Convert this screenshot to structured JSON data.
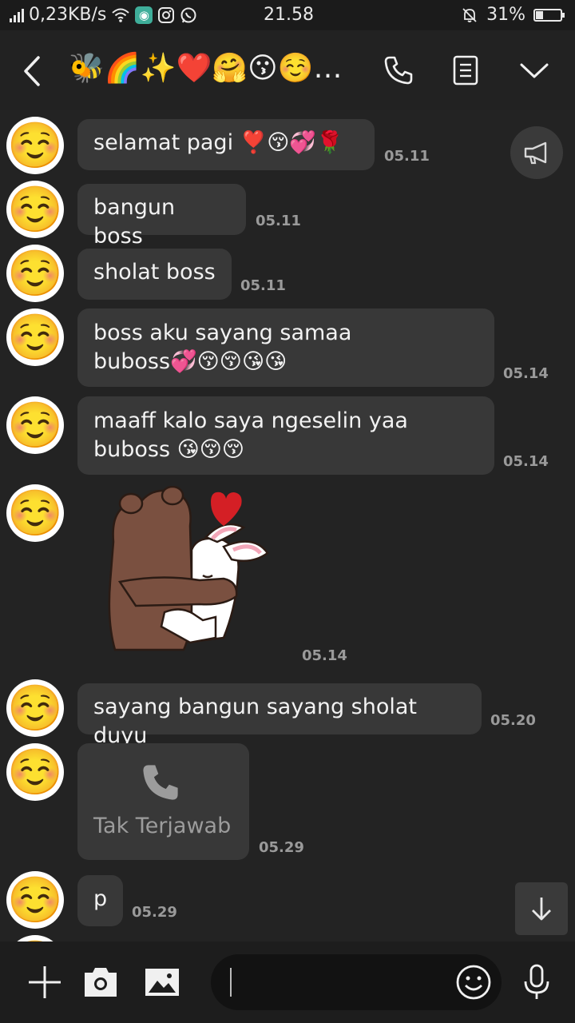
{
  "status": {
    "speed": "0,23KB/s",
    "time": "21.58",
    "battery": "31%",
    "battery_level": 0.31
  },
  "header": {
    "title": "🐝🌈✨❤️🤗😗☺️…",
    "icons": [
      "back-icon",
      "phone-icon",
      "notes-icon",
      "chevron-down-icon"
    ]
  },
  "messages": [
    {
      "text": "selamat pagi ❣️😚💞🌹",
      "time": "05.11"
    },
    {
      "text": "bangun boss",
      "time": "05.11"
    },
    {
      "text": "sholat boss",
      "time": "05.11"
    },
    {
      "line1": "boss aku sayang samaa",
      "line2": "buboss💞😚😚😘😘",
      "time": "05.14"
    },
    {
      "line1": "maaff kalo saya ngeselin yaa",
      "line2": "buboss 😘😚😚",
      "time": "05.14"
    },
    {
      "sticker": "bear-hug-bunny-sticker",
      "time": "05.14"
    },
    {
      "text": "sayang bangun sayang sholat duyu",
      "time": "05.20"
    },
    {
      "call_label": "Tak Terjawab",
      "time": "05.29"
    },
    {
      "text": "p",
      "time": "05.29"
    }
  ],
  "avatar_emoji": "☺️",
  "composer": {
    "placeholder": "",
    "icons": [
      "plus-icon",
      "camera-icon",
      "image-icon",
      "emoji-icon",
      "mic-icon"
    ]
  },
  "colors": {
    "background": "#232323",
    "bubble": "#383838",
    "timestamp": "#9a9a9a"
  }
}
